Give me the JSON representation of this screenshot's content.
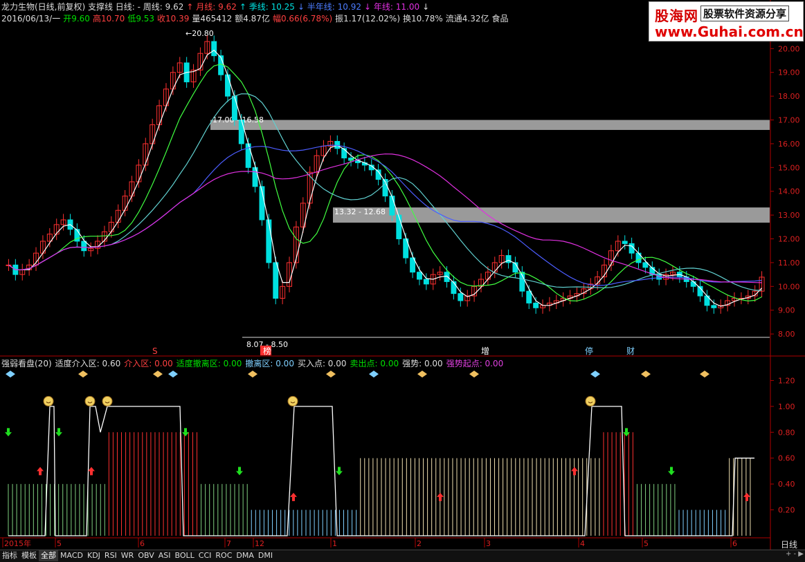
{
  "header1": [
    {
      "text": "龙力生物(日线,前复权) 支撑线  日线: - 周线: 9.62",
      "color": "#dddddd"
    },
    {
      "text": "↑ 月线: 9.62",
      "color": "#ff4040"
    },
    {
      "text": "↑ 季线: 10.25",
      "color": "#00e0e0"
    },
    {
      "text": "↓ 半年线: 10.92",
      "color": "#4c7dff"
    },
    {
      "text": "↓ 年线: 11.00",
      "color": "#e030e0"
    },
    {
      "text": "↓",
      "color": "#dddddd"
    }
  ],
  "header2": [
    {
      "text": "2016/06/13/一",
      "color": "#dddddd"
    },
    {
      "text": "开9.60",
      "color": "#00e000"
    },
    {
      "text": "高10.70",
      "color": "#ff4040"
    },
    {
      "text": "低9.53",
      "color": "#00e000"
    },
    {
      "text": "收10.39",
      "color": "#ff4040"
    },
    {
      "text": "量465412",
      "color": "#dddddd"
    },
    {
      "text": "额4.87亿",
      "color": "#dddddd"
    },
    {
      "text": "幅0.66(6.78%)",
      "color": "#ff4040"
    },
    {
      "text": "振1.17(12.02%)",
      "color": "#dddddd"
    },
    {
      "text": "换10.78%",
      "color": "#dddddd"
    },
    {
      "text": "流通4.32亿",
      "color": "#dddddd"
    },
    {
      "text": "食品",
      "color": "#dddddd"
    }
  ],
  "watermark": {
    "logo": "股海网",
    "tagline": "股票软件资源分享",
    "url": "www.Guhai.com.cn"
  },
  "indicator_header": [
    {
      "text": "强弱看盘(20)",
      "color": "#dddddd"
    },
    {
      "text": "适度介入区: 0.60",
      "color": "#dddddd"
    },
    {
      "text": "介入区: 0.00",
      "color": "#ff4040"
    },
    {
      "text": "适度撤离区: 0.00",
      "color": "#00e000"
    },
    {
      "text": "撤离区: 0.00",
      "color": "#7fd0ff"
    },
    {
      "text": "买入点: 0.00",
      "color": "#dddddd"
    },
    {
      "text": "卖出点: 0.00",
      "color": "#00e000"
    },
    {
      "text": "强势: 0.00",
      "color": "#dddddd"
    },
    {
      "text": "强势起点: 0.00",
      "color": "#e040e0"
    }
  ],
  "price_axis": [
    "20.00",
    "19.00",
    "18.00",
    "17.00",
    "16.00",
    "15.00",
    "14.00",
    "13.00",
    "12.00",
    "11.00",
    "10.00",
    "9.00",
    "8.00"
  ],
  "indicator_axis": [
    "1.20",
    "1.00",
    "0.80",
    "0.60",
    "0.40",
    "0.20"
  ],
  "time_axis": [
    "2015年",
    "5",
    "6",
    "7",
    "12",
    "1",
    "2",
    "3",
    "4",
    "5",
    "6"
  ],
  "annotations": {
    "high_price": "20.80",
    "low_price": "8.07 - 8.50",
    "resistance1": "17.00 - 16.58",
    "resistance2": "13.32 - 12.68"
  },
  "event_markers": [
    "S",
    "榜",
    "增",
    "停",
    "财"
  ],
  "period_label": "日线",
  "tabs": [
    "指标",
    "模板",
    "全部",
    "MACD",
    "KDJ",
    "RSI",
    "WR",
    "OBV",
    "ASI",
    "BOLL",
    "CCI",
    "ROC",
    "DMA",
    "DMI"
  ],
  "active_tab": "全部",
  "nav_buttons": "+ - ▶",
  "chart_data": {
    "type": "candlestick",
    "price_ylim": [
      7.8,
      20.3
    ],
    "indicator_ylim": [
      0,
      1.32
    ],
    "support_zones": [
      {
        "top": 17.0,
        "bottom": 16.58
      },
      {
        "top": 13.32,
        "bottom": 12.68
      }
    ],
    "closes": [
      10.9,
      10.5,
      10.7,
      10.9,
      11.4,
      11.9,
      12.2,
      12.6,
      12.8,
      12.4,
      11.9,
      11.5,
      11.6,
      11.9,
      12.3,
      12.7,
      13.2,
      13.8,
      14.4,
      15.1,
      16.0,
      16.8,
      17.6,
      18.3,
      19.0,
      19.4,
      18.6,
      19.1,
      19.8,
      20.3,
      19.7,
      18.9,
      18.0,
      17.0,
      16.0,
      15.0,
      14.2,
      12.8,
      11.0,
      9.5,
      10.0,
      11.0,
      12.5,
      13.5,
      14.8,
      15.5,
      15.9,
      16.1,
      15.8,
      15.4,
      15.3,
      15.2,
      15.1,
      14.9,
      14.5,
      13.8,
      13.0,
      12.0,
      11.2,
      10.6,
      10.3,
      10.1,
      10.5,
      10.6,
      10.2,
      9.7,
      9.4,
      9.6,
      10.0,
      10.3,
      10.6,
      11.0,
      11.3,
      11.0,
      10.6,
      9.8,
      9.3,
      9.1,
      9.2,
      9.3,
      9.4,
      9.5,
      9.6,
      9.7,
      9.9,
      10.1,
      10.4,
      10.9,
      11.5,
      11.9,
      11.8,
      11.4,
      11.0,
      10.8,
      10.5,
      10.3,
      10.5,
      10.6,
      10.4,
      10.2,
      10.0,
      9.6,
      9.2,
      9.1,
      9.2,
      9.4,
      9.5,
      9.5,
      9.6,
      9.8,
      10.39
    ],
    "signal_levels": [
      0.4,
      0.4,
      0.4,
      0.4,
      0.4,
      0.4,
      0.4,
      0.4,
      0.4,
      0.4,
      0.4,
      0.4,
      0.8,
      0.8,
      0.8,
      0.8,
      0.8,
      0.8,
      0.8,
      0.8,
      0.8,
      0.8,
      0.8,
      0.4,
      0.4,
      0.4,
      0.4,
      0.4,
      0.4,
      0.2,
      0.2,
      0.2,
      0.2,
      0.2,
      0.2,
      0.2,
      0.2,
      0.2,
      0.2,
      0.2,
      0.2,
      0.2,
      0.6,
      0.6,
      0.6,
      0.6,
      0.6,
      0.6,
      0.6,
      0.6,
      0.6,
      0.6,
      0.6,
      0.6,
      0.6,
      0.6,
      0.6,
      0.6,
      0.6,
      0.6,
      0.6,
      0.6,
      0.6,
      0.6,
      0.6,
      0.6,
      0.6,
      0.6,
      0.6,
      0.6,
      0.6,
      0.8,
      0.8,
      0.8,
      0.8,
      0.4,
      0.4,
      0.4,
      0.4,
      0.4,
      0.2,
      0.2,
      0.2,
      0.2,
      0.2,
      0.2,
      0.6,
      0.6,
      0.6
    ]
  }
}
